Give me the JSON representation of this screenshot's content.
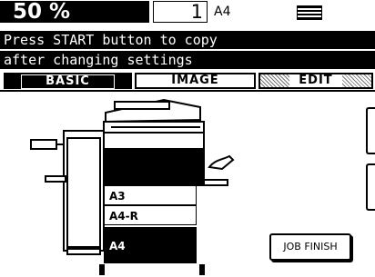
{
  "status": {
    "zoom": "50 %",
    "copies": "1",
    "paper_size": "A4"
  },
  "messages": {
    "line1": "Press START button to copy",
    "line2": "after changing settings"
  },
  "tabs": [
    {
      "label": "BASIC",
      "active": true
    },
    {
      "label": "IMAGE",
      "active": false
    },
    {
      "label": "EDIT",
      "active": false
    }
  ],
  "paper_trays": [
    {
      "label": "A3",
      "selected": false
    },
    {
      "label": "A4-R",
      "selected": false
    },
    {
      "label": "A4",
      "selected": true
    }
  ],
  "buttons": {
    "job_finish": "JOB FINISH"
  }
}
